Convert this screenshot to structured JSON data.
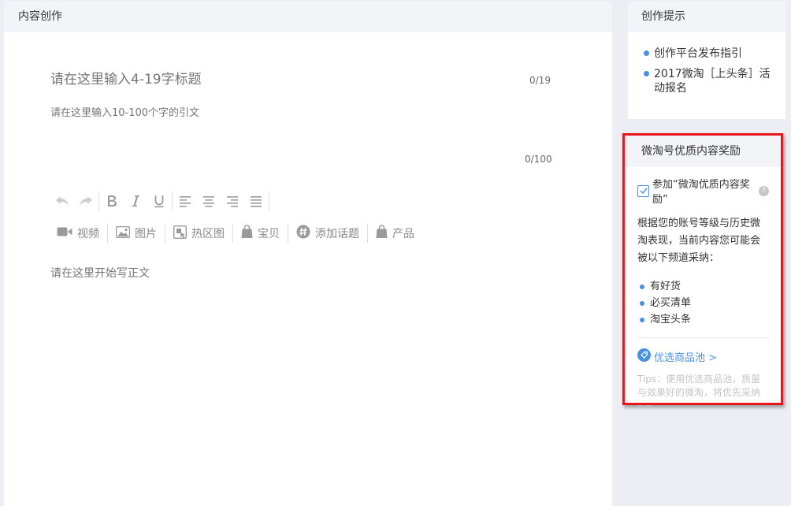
{
  "editor": {
    "header_title": "内容创作",
    "title_placeholder": "请在这里输入4-19字标题",
    "title_count": "0/19",
    "lead_placeholder": "请在这里输入10-100个字的引文",
    "lead_count": "0/100",
    "body_placeholder": "请在这里开始写正文",
    "format_tools": [
      "undo-icon",
      "redo-icon",
      "bold-icon",
      "italic-icon",
      "underline-icon",
      "align-left-icon",
      "align-center-icon",
      "align-right-icon",
      "align-justify-icon"
    ],
    "insert_tools": [
      {
        "icon": "video-icon",
        "label": "视频"
      },
      {
        "icon": "image-icon",
        "label": "图片"
      },
      {
        "icon": "hotspot-icon",
        "label": "热区图"
      },
      {
        "icon": "bag-icon",
        "label": "宝贝"
      },
      {
        "icon": "hashtag-icon",
        "label": "添加话题"
      },
      {
        "icon": "bag-icon",
        "label": "产品"
      }
    ]
  },
  "tips": {
    "header_title": "创作提示",
    "items": [
      "创作平台发布指引",
      "2017微淘［上头条］活动报名"
    ]
  },
  "reward": {
    "header_title": "微淘号优质内容奖励",
    "checkbox_label": "参加“微淘优质内容奖励”",
    "checked": true,
    "description": "根据您的账号等级与历史微淘表现，当前内容您可能会被以下频道采纳：",
    "channels": [
      "有好货",
      "必买清单",
      "淘宝头条"
    ],
    "pool_link": "优选商品池 >",
    "pool_tip": "Tips：使用优选商品池，质量与效果好的微淘，将优先采纳~~"
  },
  "colors": {
    "accent": "#4a90e2",
    "highlight_border": "#e8161b",
    "panel_header_bg": "#f3f4f7",
    "page_bg": "#eceef3"
  }
}
